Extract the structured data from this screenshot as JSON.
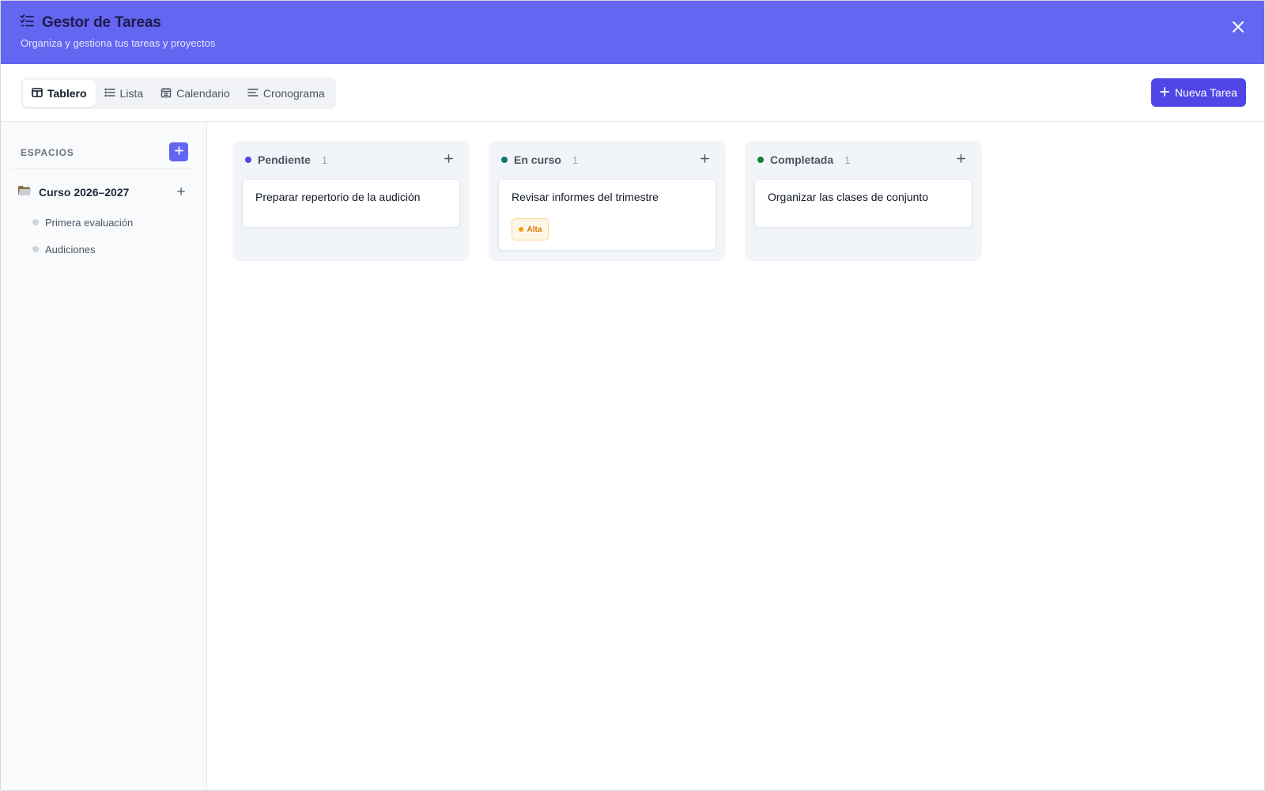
{
  "header": {
    "title": "Gestor de Tareas",
    "subtitle": "Organiza y gestiona tus tareas y proyectos",
    "icon": "task-list-icon",
    "close_icon": "close-icon",
    "background": "#6366f1"
  },
  "toolbar": {
    "tabs": [
      {
        "label": "Tablero",
        "icon": "board-icon",
        "active": true
      },
      {
        "label": "Lista",
        "icon": "list-icon",
        "active": false
      },
      {
        "label": "Calendario",
        "icon": "calendar-icon",
        "active": false
      },
      {
        "label": "Cronograma",
        "icon": "timeline-icon",
        "active": false
      }
    ],
    "new_task_label": "Nueva Tarea",
    "new_task_icon": "plus-icon",
    "accent": "#4f46e5"
  },
  "sidebar": {
    "section_label": "ESPACIOS",
    "space": {
      "name": "Curso 2026–2027",
      "icon": "folder-icon",
      "lists": [
        {
          "label": "Primera evaluación"
        },
        {
          "label": "Audiciones"
        }
      ]
    }
  },
  "board": {
    "columns": [
      {
        "title": "Pendiente",
        "count": "1",
        "dot_color": "#4f46e5",
        "cards": [
          {
            "title": "Preparar repertorio de la audición",
            "priority": ""
          }
        ]
      },
      {
        "title": "En curso",
        "count": "1",
        "dot_color": "#0f766e",
        "cards": [
          {
            "title": "Revisar informes del trimestre",
            "priority": "Alta",
            "priority_color": "#d97706"
          }
        ]
      },
      {
        "title": "Completada",
        "count": "1",
        "dot_color": "#15803d",
        "cards": [
          {
            "title": "Organizar las clases de conjunto",
            "priority": ""
          }
        ]
      }
    ]
  }
}
